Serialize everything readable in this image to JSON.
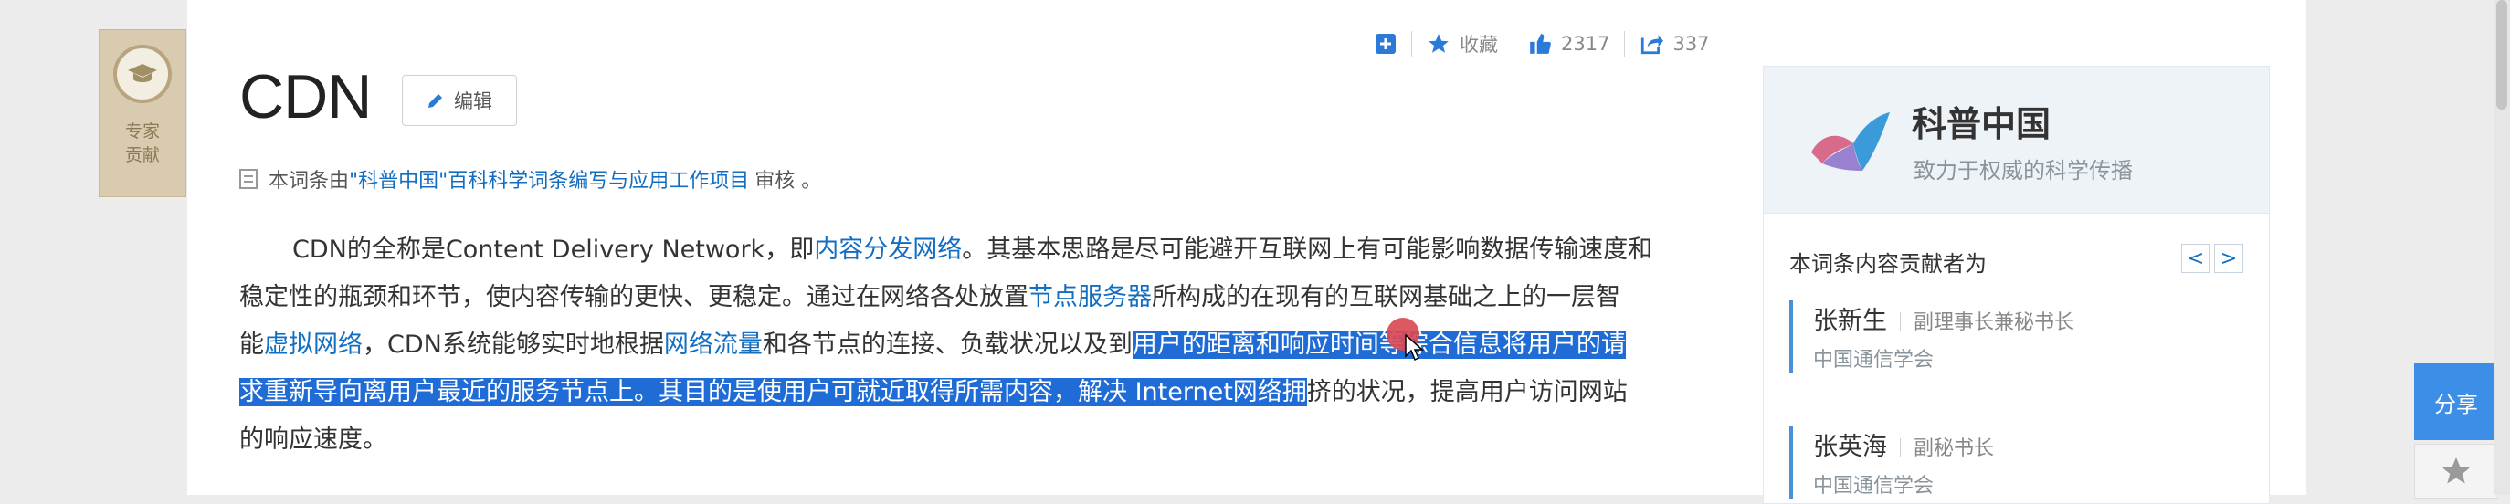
{
  "expert_badge": {
    "line1": "专家",
    "line2": "贡献"
  },
  "toolbar": {
    "collect_label": "收藏",
    "like_count": "2317",
    "share_count": "337"
  },
  "article": {
    "title": "CDN",
    "edit_label": "编辑",
    "review_prefix": "本词条由",
    "review_link": "\"科普中国\"百科科学词条编写与应用工作项目",
    "review_suffix": "审核 。",
    "para": {
      "l1_a": "CDN的全称是Content Delivery Network，即",
      "l1_link": "内容分发网络",
      "l1_b": "。其基本思路是尽可能避开互联网上有可能影响数据传输速度和",
      "l2_a": "稳定性的瓶颈和环节，使内容传输的更快、更稳定。通过在网络各处放置",
      "l2_link": "节点服务器",
      "l2_b": "所构成的在现有的互联网基础之上的一层智",
      "l3_a": "能",
      "l3_link1": "虚拟网络",
      "l3_b": "，CDN系统能够实时地根据",
      "l3_link2": "网络流量",
      "l3_c": "和各节点的连接、负载状况以及到",
      "l3_sel": "用户的距离和响应时间等综合信息将用户的请",
      "l4_sel": "求重新导向离用户最近的服务节点上。其目的是使用户可就近取得所需内容，解决 Internet网络拥",
      "l4_b": "挤的状况，提高用户访问网站",
      "l5": "的响应速度。"
    }
  },
  "sidebar": {
    "brand_name": "科普中国",
    "brand_slogan": "致力于权威的科学传播",
    "contrib_heading": "本词条内容贡献者为",
    "pager_prev": "<",
    "pager_next": ">",
    "contributors": [
      {
        "name": "张新生",
        "role": "副理事长兼秘书长",
        "org": "中国通信学会"
      },
      {
        "name": "张英海",
        "role": "副秘书长",
        "org": "中国通信学会"
      }
    ]
  },
  "floating": {
    "share_label": "分享"
  },
  "colors": {
    "link": "#136ec2",
    "selection": "#1f6cd6",
    "accent": "#3d8ee6"
  }
}
